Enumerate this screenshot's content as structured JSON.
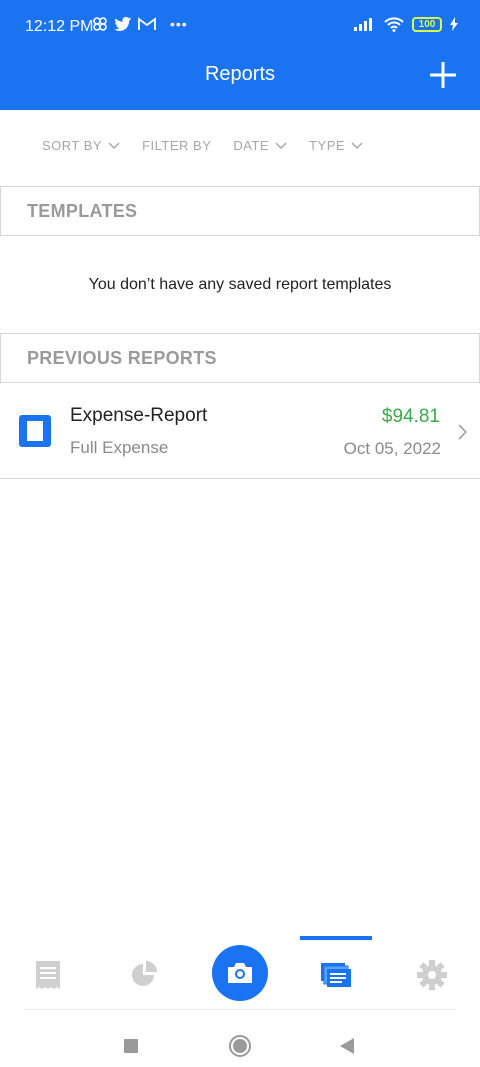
{
  "status_bar": {
    "time": "12:12 PM",
    "battery": "100",
    "icons": [
      "pinwheel-icon",
      "twitter-icon",
      "gmail-icon",
      "more-icon",
      "signal-icon",
      "wifi-icon",
      "battery-icon",
      "charging-icon"
    ]
  },
  "app_bar": {
    "title": "Reports"
  },
  "filters": {
    "sort_by": "SORT BY",
    "filter_by": "FILTER BY",
    "date": "DATE",
    "type": "TYPE"
  },
  "templates": {
    "header": "TEMPLATES",
    "empty_message": "You don’t have any saved report templates"
  },
  "previous_reports": {
    "header": "PREVIOUS REPORTS",
    "items": [
      {
        "name": "Expense-Report",
        "type": "Full Expense",
        "amount": "$94.81",
        "date": "Oct 05, 2022"
      }
    ]
  },
  "bottom_nav": {
    "items": [
      "receipts-icon",
      "pie-chart-icon",
      "camera-icon",
      "reports-icon",
      "settings-icon"
    ],
    "active": "reports"
  },
  "colors": {
    "primary": "#1a73f0",
    "amount_green": "#39a94a",
    "muted_text": "#9a9a9a"
  }
}
